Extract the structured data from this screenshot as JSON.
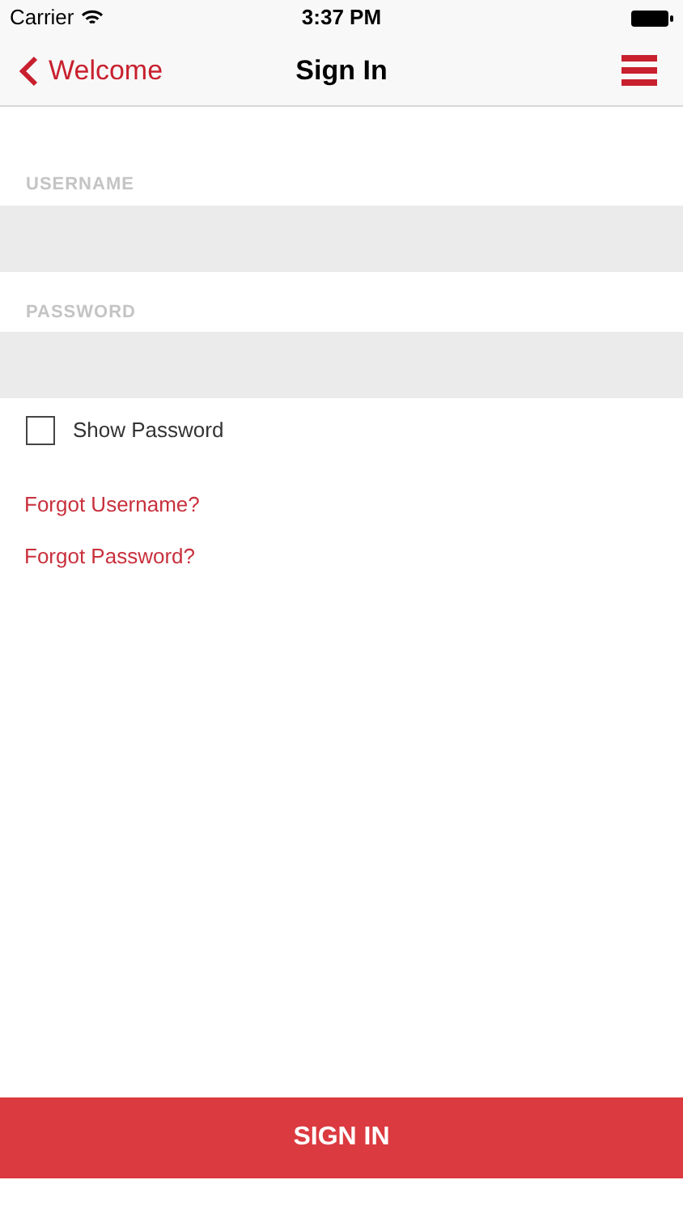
{
  "status_bar": {
    "carrier": "Carrier",
    "time": "3:37 PM"
  },
  "nav_bar": {
    "back_label": "Welcome",
    "title": "Sign In"
  },
  "fields": [
    {
      "label": "USERNAME"
    },
    {
      "label": "PASSWORD"
    }
  ],
  "show_password": {
    "label": "Show Password",
    "checked": false
  },
  "links": [
    "Forgot Username?",
    "Forgot Password?"
  ],
  "submit_button": "SIGN IN"
}
